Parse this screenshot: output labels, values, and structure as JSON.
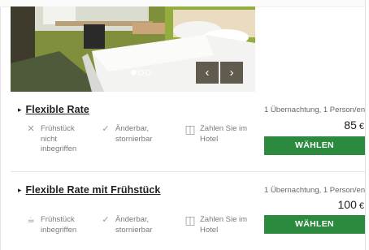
{
  "gallery": {
    "dot_count": 3,
    "active_dot": 0,
    "prev_label": "‹",
    "next_label": "›"
  },
  "rates": [
    {
      "title": "Flexible Rate",
      "occupancy": "1 Übernachtung, 1 Person/en",
      "price": "85",
      "currency": "€",
      "button_label": "WÄHLEN",
      "features": [
        {
          "icon": "x-icon",
          "text": "Frühstück nicht inbegriffen"
        },
        {
          "icon": "check-icon",
          "text": "Änderbar, stornierbar"
        },
        {
          "icon": "payment-terminal-icon",
          "text": "Zahlen Sie im Hotel"
        }
      ]
    },
    {
      "title": "Flexible Rate mit Frühstück",
      "occupancy": "1 Übernachtung, 1 Person/en",
      "price": "100",
      "currency": "€",
      "button_label": "WÄHLEN",
      "features": [
        {
          "icon": "coffee-cup-icon",
          "text": "Frühstück inbegriffen"
        },
        {
          "icon": "check-icon",
          "text": "Änderbar, stornierbar"
        },
        {
          "icon": "payment-terminal-icon",
          "text": "Zahlen Sie im Hotel"
        }
      ]
    }
  ],
  "colors": {
    "button": "#2b8a3e",
    "wall": "#8ea43a"
  }
}
